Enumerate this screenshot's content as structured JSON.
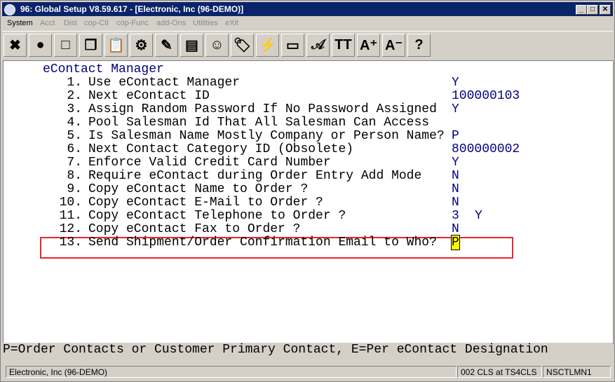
{
  "window": {
    "title": "96: Global Setup V8.59.617 - [Electronic, Inc (96-DEMO)]",
    "minimize": "_",
    "maximize": "□",
    "close": "✕"
  },
  "menu": [
    "System",
    "Acct",
    "Dist",
    "cop-Ctl",
    "cop-Func",
    "add-Ons",
    "Utilities",
    "eXit"
  ],
  "toolbar": {
    "icons": [
      "close-x-icon",
      "globe-icon",
      "select-box-icon",
      "copy-icon",
      "paste-icon",
      "settings-gear-icon",
      "edit-pencil-icon",
      "notes-icon",
      "users-icon",
      "tag-icon",
      "lightning-icon",
      "window-icon",
      "font-script-icon",
      "text-font-icon",
      "font-larger-icon",
      "font-smaller-icon",
      "help-icon"
    ],
    "glyphs": [
      "✖",
      "●",
      "□",
      "❐",
      "📋",
      "⚙",
      "✎",
      "▤",
      "☺",
      "🏷",
      "⚡",
      "▭",
      "𝒜",
      "TT",
      "A⁺",
      "A⁻",
      "?"
    ]
  },
  "screen": {
    "heading": "eContact Manager",
    "items": [
      {
        "num": "1.",
        "label": "Use eContact Manager",
        "value": "Y"
      },
      {
        "num": "2.",
        "label": "Next eContact ID",
        "value": "100000103"
      },
      {
        "num": "3.",
        "label": "Assign Random Password If No Password Assigned",
        "value": "Y"
      },
      {
        "num": "4.",
        "label": "Pool Salesman Id That All Salesman Can Access",
        "value": ""
      },
      {
        "num": "5.",
        "label": "Is Salesman Name Mostly Company or Person Name?",
        "value": "P"
      },
      {
        "num": "6.",
        "label": "Next Contact Category ID (Obsolete)",
        "value": "800000002"
      },
      {
        "num": "7.",
        "label": "Enforce Valid Credit Card Number",
        "value": "Y"
      },
      {
        "num": "8.",
        "label": "Require eContact during Order Entry Add Mode",
        "value": "N"
      },
      {
        "num": "9.",
        "label": "Copy eContact Name to Order ?",
        "value": "N"
      },
      {
        "num": "10.",
        "label": "Copy eContact E-Mail to Order ?",
        "value": "N"
      },
      {
        "num": "11.",
        "label": "Copy eContact Telephone to Order ?",
        "value": "3",
        "extra": "Y"
      },
      {
        "num": "12.",
        "label": "Copy eContact Fax to Order ?",
        "value": "N"
      },
      {
        "num": "13.",
        "label": "Send Shipment/Order Confirmation Email to Who?",
        "value": "P"
      }
    ]
  },
  "hint": "P=Order Contacts or Customer Primary Contact, E=Per eContact Designation",
  "status": {
    "company": "Electronic, Inc (96-DEMO)",
    "session": "002 CLS at TS4CLS",
    "program": "NSCTLMN1"
  }
}
